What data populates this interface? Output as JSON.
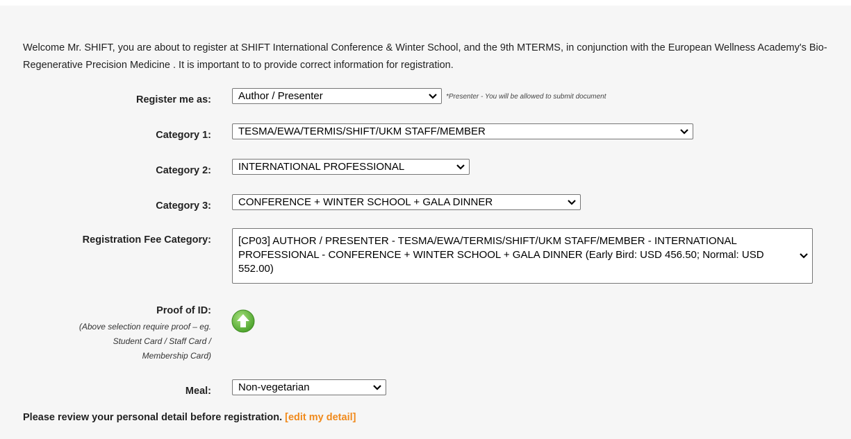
{
  "intro_text": "Welcome Mr. SHIFT, you are about to register at SHIFT International Conference & Winter School, and the 9th MTERMS, in conjunction with the European Wellness Academy's Bio-Regenerative Precision Medicine . It is important to to provide correct information for registration.",
  "form": {
    "register_as": {
      "label": "Register me as:",
      "value": "Author / Presenter",
      "note": "*Presenter - You will be allowed to submit document"
    },
    "category1": {
      "label": "Category 1:",
      "value": "TESMA/EWA/TERMIS/SHIFT/UKM STAFF/MEMBER"
    },
    "category2": {
      "label": "Category 2:",
      "value": "INTERNATIONAL PROFESSIONAL"
    },
    "category3": {
      "label": "Category 3:",
      "value": "CONFERENCE + WINTER SCHOOL + GALA DINNER"
    },
    "fee_category": {
      "label": "Registration Fee Category:",
      "value": "[CP03] AUTHOR / PRESENTER - TESMA/EWA/TERMIS/SHIFT/UKM STAFF/MEMBER - INTERNATIONAL PROFESSIONAL - CONFERENCE + WINTER SCHOOL + GALA DINNER (Early Bird: USD 456.50; Normal: USD 552.00)"
    },
    "proof_of_id": {
      "label": "Proof of ID:",
      "sub_line1": "(Above selection require proof – eg.",
      "sub_line2": "Student Card / Staff Card /",
      "sub_line3": "Membership Card)",
      "icon": "upload-arrow-icon"
    },
    "meal": {
      "label": "Meal:",
      "value": "Non-vegetarian"
    }
  },
  "footer": {
    "text": "Please review your personal detail before registration.",
    "link": "[edit my detail]"
  },
  "colors": {
    "background": "#f6f6f6",
    "link": "#f08a1c",
    "upload_icon": "#6cc04a"
  }
}
